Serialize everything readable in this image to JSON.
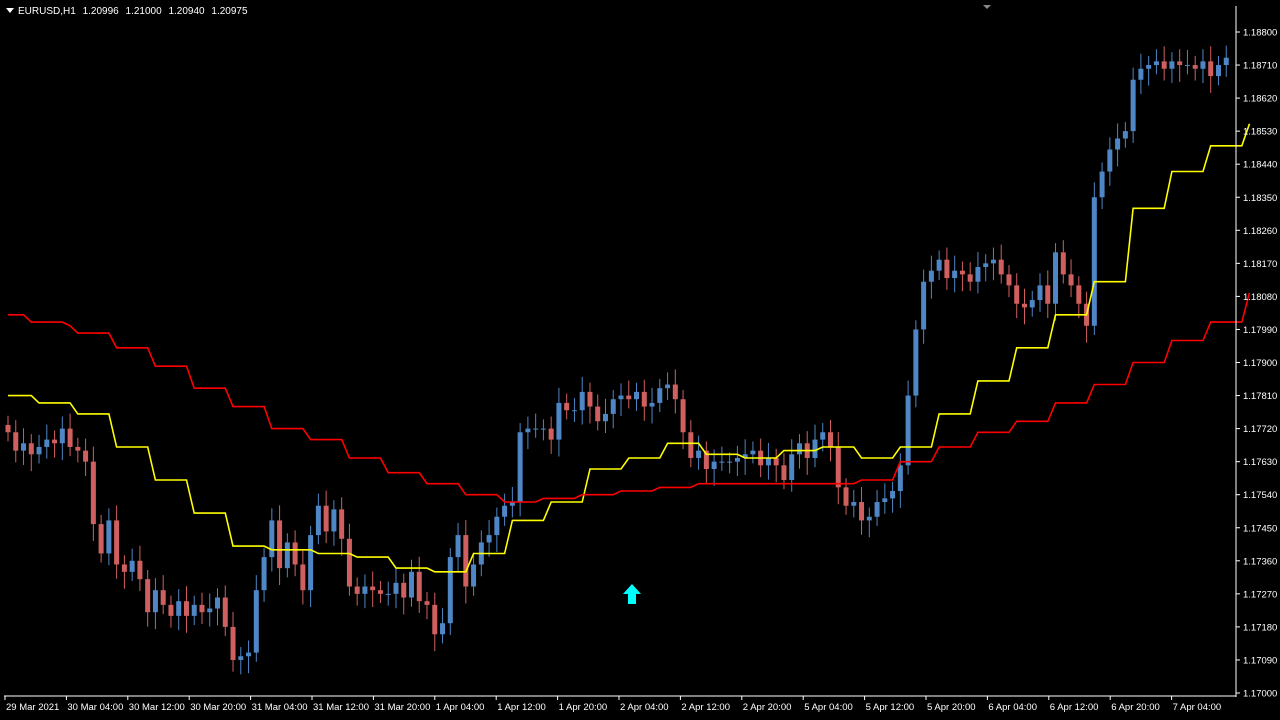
{
  "header": {
    "symbol": "EURUSD,H1",
    "open": "1.20996",
    "high": "1.21000",
    "low": "1.20940",
    "close": "1.20975"
  },
  "colors": {
    "background": "#000000",
    "bull_candle": "#4f86c6",
    "bear_candle": "#d06060",
    "line_upper": "#ffff00",
    "line_lower": "#ff0000",
    "arrow": "#00ffff",
    "axis": "#ffffff"
  },
  "chart_data": {
    "type": "candlestick",
    "x_labels": [
      "29 Mar 2021",
      "30 Mar 04:00",
      "30 Mar 12:00",
      "30 Mar 20:00",
      "31 Mar 04:00",
      "31 Mar 12:00",
      "31 Mar 20:00",
      "1 Apr 04:00",
      "1 Apr 12:00",
      "1 Apr 20:00",
      "2 Apr 04:00",
      "2 Apr 12:00",
      "2 Apr 20:00",
      "5 Apr 04:00",
      "5 Apr 12:00",
      "5 Apr 20:00",
      "6 Apr 04:00",
      "6 Apr 12:00",
      "6 Apr 20:00",
      "7 Apr 04:00"
    ],
    "y_ticks": [
      "1.18800",
      "1.18710",
      "1.18620",
      "1.18530",
      "1.18440",
      "1.18350",
      "1.18260",
      "1.18170",
      "1.18080",
      "1.17990",
      "1.17900",
      "1.17810",
      "1.17720",
      "1.17630",
      "1.17540",
      "1.17450",
      "1.17360",
      "1.17270",
      "1.17180",
      "1.17090",
      "1.17000"
    ],
    "ylim": [
      1.17,
      1.188
    ],
    "close": [
      1.1771,
      1.1766,
      1.1768,
      1.1765,
      1.1767,
      1.1769,
      1.1768,
      1.1772,
      1.1767,
      1.1766,
      1.1763,
      1.1746,
      1.1738,
      1.1747,
      1.1735,
      1.1733,
      1.1736,
      1.1731,
      1.1722,
      1.1728,
      1.1724,
      1.1721,
      1.1725,
      1.1721,
      1.1724,
      1.1722,
      1.1723,
      1.1726,
      1.1718,
      1.1709,
      1.171,
      1.1711,
      1.1728,
      1.1737,
      1.1747,
      1.1734,
      1.1741,
      1.1735,
      1.1728,
      1.1743,
      1.1751,
      1.1744,
      1.175,
      1.1742,
      1.1729,
      1.1727,
      1.1729,
      1.1728,
      1.1727,
      1.1727,
      1.173,
      1.1726,
      1.1733,
      1.1725,
      1.1724,
      1.1716,
      1.1719,
      1.1737,
      1.1743,
      1.1729,
      1.1735,
      1.1741,
      1.1743,
      1.1748,
      1.1751,
      1.1752,
      1.1771,
      1.1772,
      1.1772,
      1.1772,
      1.1769,
      1.1779,
      1.1777,
      1.1777,
      1.1782,
      1.1778,
      1.1774,
      1.1776,
      1.178,
      1.1781,
      1.178,
      1.1782,
      1.1778,
      1.1779,
      1.1783,
      1.1784,
      1.178,
      1.1771,
      1.1764,
      1.1766,
      1.1761,
      1.1763,
      1.1763,
      1.1763,
      1.1764,
      1.1765,
      1.1766,
      1.1762,
      1.1764,
      1.1762,
      1.1758,
      1.1765,
      1.1768,
      1.1764,
      1.1769,
      1.1771,
      1.1767,
      1.1756,
      1.1751,
      1.1752,
      1.1747,
      1.1748,
      1.1752,
      1.1753,
      1.1755,
      1.1762,
      1.1781,
      1.1799,
      1.1812,
      1.1815,
      1.1818,
      1.1813,
      1.1815,
      1.1814,
      1.1812,
      1.1816,
      1.1817,
      1.1818,
      1.1814,
      1.1811,
      1.1806,
      1.1805,
      1.1807,
      1.1811,
      1.1806,
      1.182,
      1.1814,
      1.1811,
      1.1806,
      1.18,
      1.1835,
      1.1842,
      1.1848,
      1.1851,
      1.1853,
      1.1867,
      1.187,
      1.1871,
      1.1872,
      1.187,
      1.1872,
      1.1871,
      1.1871,
      1.187,
      1.1872,
      1.1868,
      1.1871,
      1.1873
    ],
    "series": [
      {
        "name": "upper",
        "values": [
          1.1781,
          1.1781,
          1.1781,
          1.1781,
          1.1779,
          1.1779,
          1.1779,
          1.1779,
          1.1779,
          1.1776,
          1.1776,
          1.1776,
          1.1776,
          1.1776,
          1.1767,
          1.1767,
          1.1767,
          1.1767,
          1.1767,
          1.1758,
          1.1758,
          1.1758,
          1.1758,
          1.1758,
          1.1749,
          1.1749,
          1.1749,
          1.1749,
          1.1749,
          1.174,
          1.174,
          1.174,
          1.174,
          1.174,
          1.1739,
          1.1739,
          1.1739,
          1.1739,
          1.1739,
          1.1739,
          1.1738,
          1.1738,
          1.1738,
          1.1738,
          1.1738,
          1.1737,
          1.1737,
          1.1737,
          1.1737,
          1.1737,
          1.1734,
          1.1734,
          1.1734,
          1.1734,
          1.1734,
          1.1733,
          1.1733,
          1.1733,
          1.1733,
          1.1733,
          1.1738,
          1.1738,
          1.1738,
          1.1738,
          1.1738,
          1.1747,
          1.1747,
          1.1747,
          1.1747,
          1.1747,
          1.1752,
          1.1752,
          1.1752,
          1.1752,
          1.1752,
          1.1761,
          1.1761,
          1.1761,
          1.1761,
          1.1761,
          1.1764,
          1.1764,
          1.1764,
          1.1764,
          1.1764,
          1.1768,
          1.1768,
          1.1768,
          1.1768,
          1.1768,
          1.1765,
          1.1765,
          1.1765,
          1.1765,
          1.1765,
          1.1764,
          1.1764,
          1.1764,
          1.1764,
          1.1764,
          1.1766,
          1.1766,
          1.1766,
          1.1766,
          1.1766,
          1.1767,
          1.1767,
          1.1767,
          1.1767,
          1.1767,
          1.1764,
          1.1764,
          1.1764,
          1.1764,
          1.1764,
          1.1767,
          1.1767,
          1.1767,
          1.1767,
          1.1767,
          1.1776,
          1.1776,
          1.1776,
          1.1776,
          1.1776,
          1.1785,
          1.1785,
          1.1785,
          1.1785,
          1.1785,
          1.1794,
          1.1794,
          1.1794,
          1.1794,
          1.1794,
          1.1803,
          1.1803,
          1.1803,
          1.1803,
          1.1803,
          1.1812,
          1.1812,
          1.1812,
          1.1812,
          1.1812,
          1.1832,
          1.1832,
          1.1832,
          1.1832,
          1.1832,
          1.1842,
          1.1842,
          1.1842,
          1.1842,
          1.1842,
          1.1849,
          1.1849,
          1.1849,
          1.1849,
          1.1849,
          1.1855
        ]
      },
      {
        "name": "lower",
        "values": [
          1.1803,
          1.1803,
          1.1803,
          1.1801,
          1.1801,
          1.1801,
          1.1801,
          1.1801,
          1.18,
          1.1798,
          1.1798,
          1.1798,
          1.1798,
          1.1798,
          1.1794,
          1.1794,
          1.1794,
          1.1794,
          1.1794,
          1.1789,
          1.1789,
          1.1789,
          1.1789,
          1.1789,
          1.1783,
          1.1783,
          1.1783,
          1.1783,
          1.1783,
          1.1778,
          1.1778,
          1.1778,
          1.1778,
          1.1778,
          1.1772,
          1.1772,
          1.1772,
          1.1772,
          1.1772,
          1.1769,
          1.1769,
          1.1769,
          1.1769,
          1.1769,
          1.1764,
          1.1764,
          1.1764,
          1.1764,
          1.1764,
          1.176,
          1.176,
          1.176,
          1.176,
          1.176,
          1.1757,
          1.1757,
          1.1757,
          1.1757,
          1.1757,
          1.1754,
          1.1754,
          1.1754,
          1.1754,
          1.1754,
          1.1752,
          1.1752,
          1.1752,
          1.1752,
          1.1752,
          1.1753,
          1.1753,
          1.1753,
          1.1753,
          1.1753,
          1.1754,
          1.1754,
          1.1754,
          1.1754,
          1.1754,
          1.1755,
          1.1755,
          1.1755,
          1.1755,
          1.1755,
          1.1756,
          1.1756,
          1.1756,
          1.1756,
          1.1756,
          1.1757,
          1.1757,
          1.1757,
          1.1757,
          1.1757,
          1.1757,
          1.1757,
          1.1757,
          1.1757,
          1.1757,
          1.1757,
          1.1757,
          1.1757,
          1.1757,
          1.1757,
          1.1757,
          1.1757,
          1.1757,
          1.1757,
          1.1757,
          1.1757,
          1.1758,
          1.1758,
          1.1758,
          1.1758,
          1.1758,
          1.1763,
          1.1763,
          1.1763,
          1.1763,
          1.1763,
          1.1767,
          1.1767,
          1.1767,
          1.1767,
          1.1767,
          1.1771,
          1.1771,
          1.1771,
          1.1771,
          1.1771,
          1.1774,
          1.1774,
          1.1774,
          1.1774,
          1.1774,
          1.1779,
          1.1779,
          1.1779,
          1.1779,
          1.1779,
          1.1784,
          1.1784,
          1.1784,
          1.1784,
          1.1784,
          1.179,
          1.179,
          1.179,
          1.179,
          1.179,
          1.1796,
          1.1796,
          1.1796,
          1.1796,
          1.1796,
          1.1801,
          1.1801,
          1.1801,
          1.1801,
          1.1801,
          1.1809
        ]
      }
    ],
    "arrow": {
      "direction": "up",
      "label": ""
    }
  }
}
